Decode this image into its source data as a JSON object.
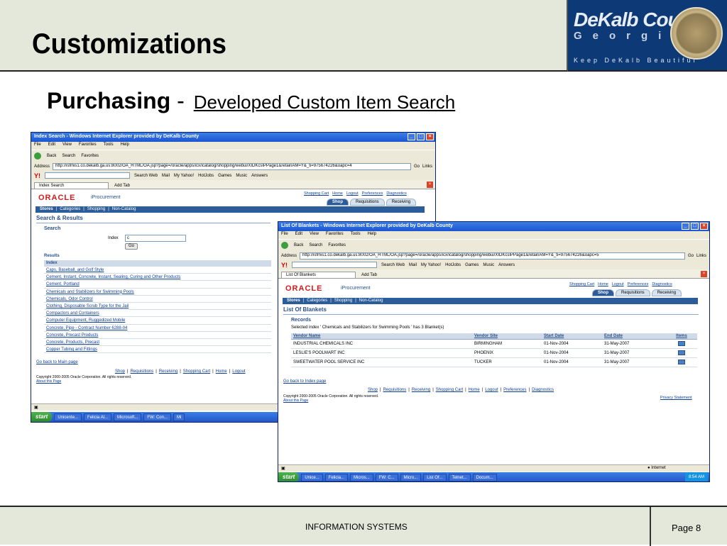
{
  "slide": {
    "title": "Customizations",
    "subtitle_bold": "Purchasing",
    "subtitle_dash": "-",
    "subtitle_link": "Developed Custom Item Search",
    "footer_center": "INFORMATION SYSTEMS",
    "footer_page": "Page 8"
  },
  "logo": {
    "line1": "DeKalb County",
    "line2": "Georgia",
    "line3": "Keep DeKalb Beautiful"
  },
  "browser": {
    "menu": [
      "File",
      "Edit",
      "View",
      "Favorites",
      "Tools",
      "Help"
    ],
    "toolbar": [
      "Back",
      "Search",
      "Favorites"
    ],
    "address_label": "Address",
    "go": "Go",
    "links": "Links",
    "yahoo": {
      "search_web": "Search Web",
      "items": [
        "Mail",
        "My Yahoo!",
        "HotJobs",
        "Games",
        "Music",
        "Answers"
      ]
    },
    "add_tab": "Add Tab"
  },
  "win1": {
    "title": "Index Search - Windows Internet Explorer provided by DeKalb County",
    "url": "http://isfmis1.co.dekalb.ga.us:8002/OA_HTML/OA.jsp?page=/oracle/apps/icx/icatalog/shopping/webui/XIDKcsIPPage1&retainAM=Y&_ti=975674226&oapc=4",
    "tab": "Index Search",
    "oracle": "ORACLE",
    "iproc": "iProcurement",
    "toplinks": [
      "Shopping Cart",
      "Home",
      "Logout",
      "Preferences",
      "Diagnostics"
    ],
    "ptabs": [
      "Shop",
      "Requisitions",
      "Receiving"
    ],
    "nav": [
      "Stores",
      "Categories",
      "Shopping",
      "Non-Catalog"
    ],
    "heading": "Search & Results",
    "search_label": "Search",
    "index_label": "Index",
    "index_value": "c",
    "go_button": "Go",
    "results_label": "Results",
    "col_header": "Index",
    "rows": [
      "Caps, Baseball, and Golf Style",
      "Cement, Instant, Concrete, Instant, Sealing, Curing and Other Products",
      "Cement, Portland",
      "Chemicals and Stabilizers for Swimming Pools",
      "Chemicals, Odor Control",
      "Clothing, Disposable Scrub Type for the Jail",
      "Compactors and Containers",
      "Computer Equipment, Ruggedized Mobile",
      "Concrete, Pipe - Contract Number 6288-04",
      "Concrete, Precast Products",
      "Concrete, Products, Precast",
      "Copper Tubing and Fittings"
    ],
    "back_link": "Go back to Main page",
    "footer_links": [
      "Shop",
      "Requisitions",
      "Receiving",
      "Shopping Cart",
      "Home",
      "Logout"
    ],
    "copyright": "Copyright 2000-2005 Oracle Corporation. All rights reserved.",
    "about": "About this Page",
    "taskbar": [
      "start",
      "Unicente...",
      "Felicia Al...",
      "Microsoft...",
      "FW: Con...",
      "Mi"
    ]
  },
  "win2": {
    "title": "List Of Blankets - Windows Internet Explorer provided by DeKalb County",
    "url": "http://isfmis1.co.dekalb.ga.us:8002/OA_HTML/OA.jsp?page=/oracle/apps/icx/icatalog/shopping/webui/XIDKcsIPPage1&retainAM=Y&_ti=975674226&oapc=5",
    "tab": "List Of Blankets",
    "oracle": "ORACLE",
    "iproc": "iProcurement",
    "toplinks": [
      "Shopping Cart",
      "Home",
      "Logout",
      "Preferences",
      "Diagnostics"
    ],
    "ptabs": [
      "Shop",
      "Requisitions",
      "Receiving"
    ],
    "nav": [
      "Stores",
      "Categories",
      "Shopping",
      "Non-Catalog"
    ],
    "heading": "List Of Blankets",
    "records_label": "Records",
    "selected_text": "Selected index ' Chemicals and Stabilizers for Swimming Pools ' has 3 Blanket(s)",
    "columns": [
      "Vendor Name",
      "Vendor Site",
      "Start Date",
      "End Date",
      "Items"
    ],
    "rows": [
      [
        "INDUSTRIAL CHEMICALS INC",
        "BIRMINGHAM",
        "01-Nov-2004",
        "31-May-2007"
      ],
      [
        "LESLIE'S POOLMART INC",
        "PHOENIX",
        "01-Nov-2004",
        "31-May-2007"
      ],
      [
        "SWEETWATER POOL SERVICE INC",
        "TUCKER",
        "01-Nov-2004",
        "31-May-2007"
      ]
    ],
    "back_link": "Go back to Index page",
    "footer_links": [
      "Shop",
      "Requisitions",
      "Receiving",
      "Shopping Cart",
      "Home",
      "Logout",
      "Preferences",
      "Diagnostics"
    ],
    "copyright": "Copyright 2000-2005 Oracle Corporation. All rights reserved.",
    "about": "About this Page",
    "privacy": "Privacy Statement",
    "status_zone": "Internet",
    "taskbar": [
      "start",
      "Unice...",
      "Felicia...",
      "Micros...",
      "FW: C...",
      "Micro...",
      "List Of...",
      "Telnet...",
      "Docum..."
    ],
    "clock": "8:54 AM"
  }
}
